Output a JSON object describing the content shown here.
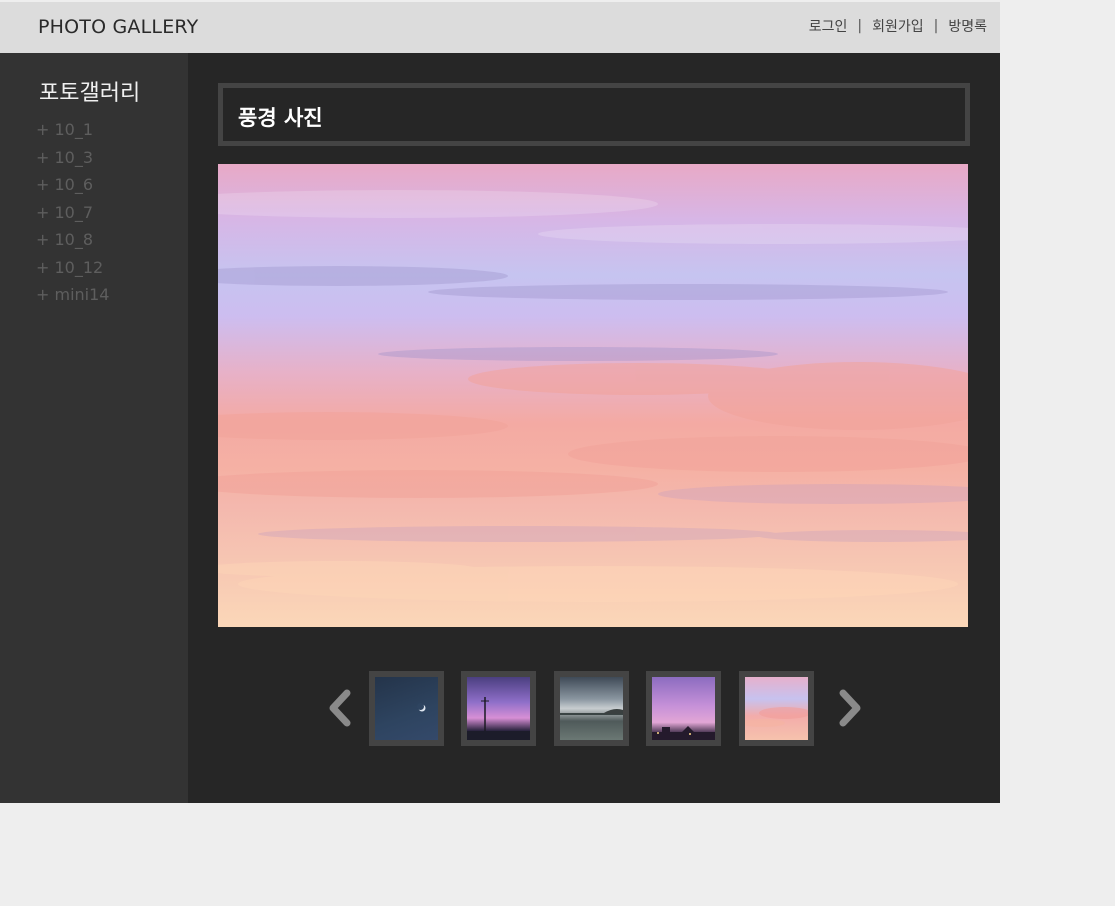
{
  "header": {
    "site_title": "PHOTO GALLERY",
    "nav": [
      {
        "label": "로그인"
      },
      {
        "label": "회원가입"
      },
      {
        "label": "방명록"
      }
    ],
    "separator": "|"
  },
  "sidebar": {
    "title": "포토갤러리",
    "items": [
      {
        "label": "+ 10_1"
      },
      {
        "label": "+ 10_3"
      },
      {
        "label": "+ 10_6"
      },
      {
        "label": "+ 10_7"
      },
      {
        "label": "+ 10_8"
      },
      {
        "label": "+ 10_12"
      },
      {
        "label": "+ mini14"
      }
    ]
  },
  "main": {
    "heading": "풍경 사진",
    "main_photo": {
      "subject": "pink and lavender sunset sky"
    },
    "thumbnails": [
      {
        "subject": "night sky with crescent moon"
      },
      {
        "subject": "purple sunset with utility pole"
      },
      {
        "subject": "cloudy sea horizon"
      },
      {
        "subject": "purple sky over rooftops"
      },
      {
        "subject": "pink sunset clouds"
      }
    ],
    "prev_icon": "chevron-left-icon",
    "next_icon": "chevron-right-icon"
  },
  "colors": {
    "page_background": "#eeeeee",
    "header_background": "#dcdcdc",
    "sidebar_background": "#333333",
    "main_background": "#262626",
    "frame_border": "#444444",
    "sidebar_item_text": "#5e5e5e"
  }
}
